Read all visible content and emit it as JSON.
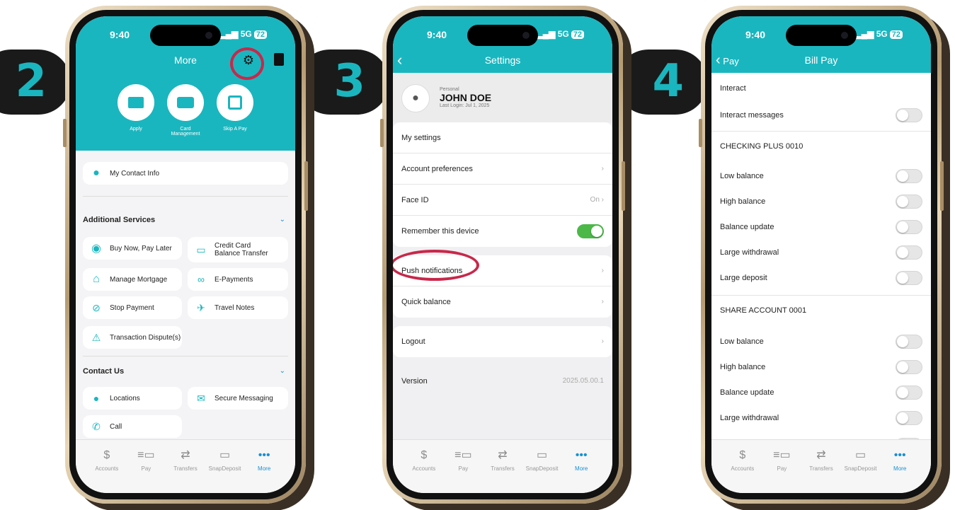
{
  "steps": [
    "2",
    "3",
    "4"
  ],
  "status": {
    "time": "9:40",
    "network": "5G",
    "battery": "72"
  },
  "tabbar": [
    {
      "label": "Accounts",
      "icon": "dollar-circle-icon"
    },
    {
      "label": "Pay",
      "icon": "pay-icon"
    },
    {
      "label": "Transfers",
      "icon": "transfer-arrows-icon"
    },
    {
      "label": "SnapDeposit",
      "icon": "snapdeposit-icon"
    },
    {
      "label": "More",
      "icon": "more-dots-icon",
      "active": true
    }
  ],
  "phone_more": {
    "title": "More",
    "quick": [
      {
        "label": "Apply",
        "icon": "folder-icon"
      },
      {
        "label": "Card Management",
        "icon": "card-icon"
      },
      {
        "label": "Skip A Pay",
        "icon": "calendar-skip-icon"
      }
    ],
    "contact_info": "My Contact Info",
    "additional_title": "Additional Services",
    "additional": [
      "Buy Now, Pay Later",
      "Credit Card Balance Transfer",
      "Manage Mortgage",
      "E-Payments",
      "Stop Payment",
      "Travel Notes",
      "Transaction Dispute(s)"
    ],
    "contact_title": "Contact Us",
    "contact": [
      "Locations",
      "Secure Messaging",
      "Call"
    ]
  },
  "phone_settings": {
    "title": "Settings",
    "profile": {
      "type": "Personal",
      "name": "JOHN DOE",
      "last_login": "Last Login: Jul 1, 2025"
    },
    "group1": [
      {
        "label": "My settings"
      },
      {
        "label": "Account preferences",
        "right": "›"
      },
      {
        "label": "Face ID",
        "right": "On ›"
      },
      {
        "label": "Remember this device",
        "toggle": true
      }
    ],
    "group2": [
      {
        "label": "Push notifications",
        "right": "›"
      },
      {
        "label": "Quick balance",
        "right": "›"
      }
    ],
    "logout": "Logout",
    "version_label": "Version",
    "version": "2025.05.00.1"
  },
  "phone_billpay": {
    "back": "Pay",
    "title": "Bill Pay",
    "interact_title": "Interact",
    "interact_row": "Interact messages",
    "checking_title": "CHECKING PLUS 0010",
    "share_title": "SHARE ACCOUNT 0001",
    "alerts": [
      "Low balance",
      "High balance",
      "Balance update",
      "Large withdrawal",
      "Large deposit"
    ]
  },
  "colors": {
    "teal": "#1ab6bf",
    "highlight": "#c8284a",
    "toggle_on": "#4cb848",
    "active_tab": "#1a8fd0"
  }
}
